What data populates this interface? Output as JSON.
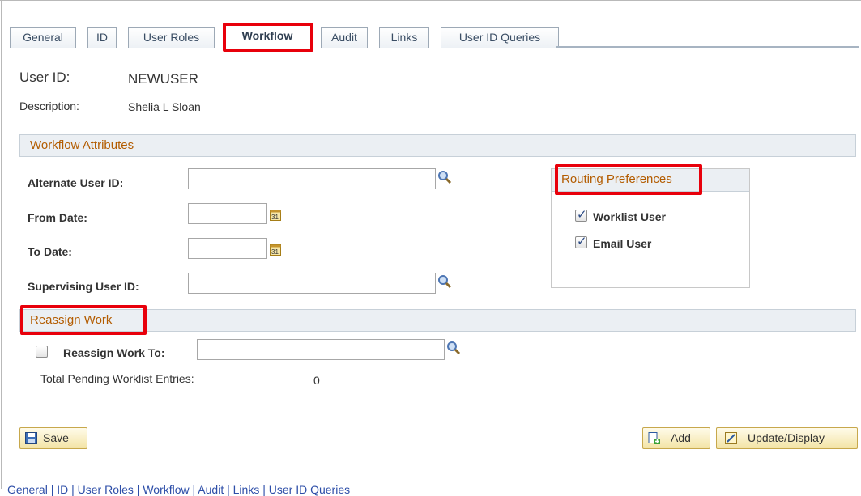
{
  "tabs": [
    {
      "label": "General"
    },
    {
      "label": "ID"
    },
    {
      "label": "User Roles"
    },
    {
      "label": "Workflow"
    },
    {
      "label": "Audit"
    },
    {
      "label": "Links"
    },
    {
      "label": "User ID Queries"
    }
  ],
  "header": {
    "user_id_label": "User ID:",
    "user_id_value": "NEWUSER",
    "description_label": "Description:",
    "description_value": "Shelia L Sloan"
  },
  "workflow_attributes": {
    "title": "Workflow Attributes",
    "alternate_user_id_label": "Alternate User ID:",
    "alternate_user_id_value": "",
    "from_date_label": "From Date:",
    "from_date_value": "",
    "to_date_label": "To Date:",
    "to_date_value": "",
    "supervising_user_id_label": "Supervising User ID:",
    "supervising_user_id_value": ""
  },
  "routing_preferences": {
    "title": "Routing Preferences",
    "worklist_user_label": "Worklist User",
    "worklist_user_checked": true,
    "email_user_label": "Email User",
    "email_user_checked": true
  },
  "reassign_work": {
    "title": "Reassign Work",
    "reassign_to_label": "Reassign Work To:",
    "reassign_checked": false,
    "reassign_to_value": "",
    "total_pending_label": "Total Pending Worklist Entries:",
    "total_pending_value": "0"
  },
  "toolbar": {
    "save_label": "Save",
    "add_label": "Add",
    "update_display_label": "Update/Display"
  },
  "footer_links": [
    "General",
    "ID",
    "User Roles",
    "Workflow",
    "Audit",
    "Links",
    "User ID Queries"
  ],
  "colors": {
    "section_title": "#b35c00",
    "highlight": "#e8000b",
    "link": "#2d4ea8"
  }
}
